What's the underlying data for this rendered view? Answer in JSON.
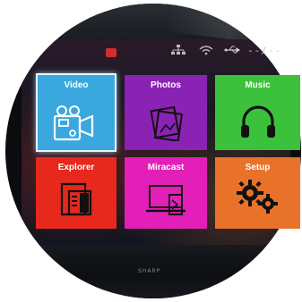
{
  "status_bar": {
    "time": "--/--",
    "icons": [
      "record-icon",
      "network-icon",
      "wifi-icon",
      "usb-icon"
    ]
  },
  "tiles": [
    {
      "label": "Video",
      "icon": "video-camera-icon",
      "color": "#3aa7de",
      "selected": true
    },
    {
      "label": "Photos",
      "icon": "photos-icon",
      "color": "#8a22b4",
      "selected": false
    },
    {
      "label": "Music",
      "icon": "headphones-icon",
      "color": "#3cc13c",
      "selected": false
    },
    {
      "label": "Explorer",
      "icon": "folder-icon",
      "color": "#e7281d",
      "selected": false
    },
    {
      "label": "Miracast",
      "icon": "devices-icon",
      "color": "#e21fb7",
      "selected": false
    },
    {
      "label": "Setup",
      "icon": "gears-icon",
      "color": "#e9722a",
      "selected": false
    }
  ],
  "brand": "SHARP"
}
